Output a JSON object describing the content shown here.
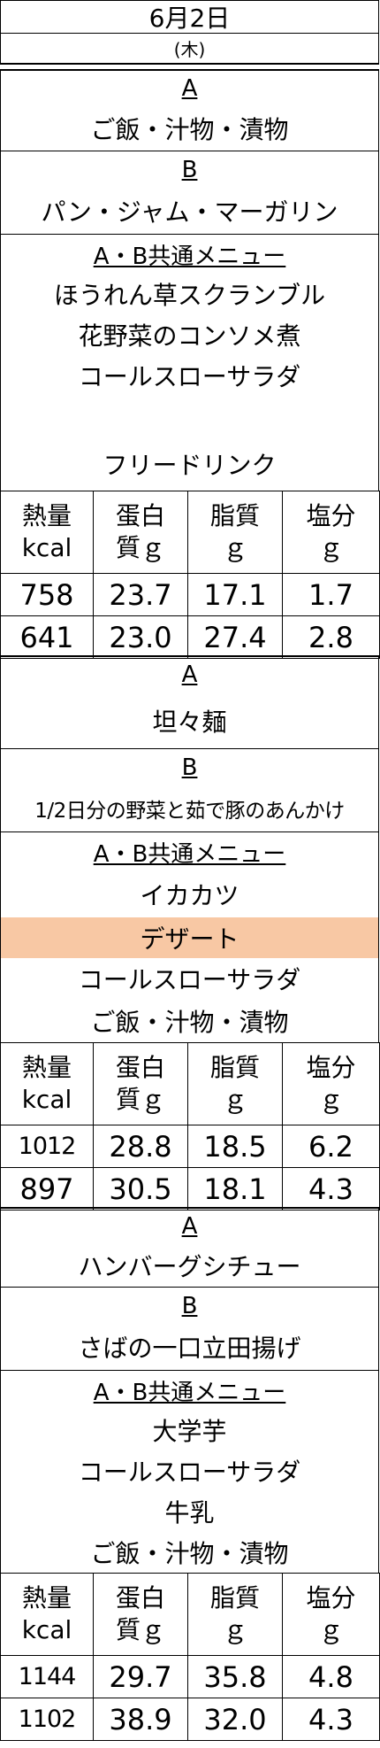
{
  "header": {
    "date": "6月2日",
    "weekday": "(木)"
  },
  "labels": {
    "a": "A",
    "b": "B",
    "common": "A・B共通メニュー"
  },
  "nutrition_headers": {
    "energy": [
      "熱量",
      "kcal"
    ],
    "protein": [
      "蛋白",
      "質ｇ"
    ],
    "fat": [
      "脂質",
      "ｇ"
    ],
    "salt": [
      "塩分",
      "ｇ"
    ]
  },
  "meals": [
    {
      "a_menu": "ご飯・汁物・漬物",
      "b_menu": "パン・ジャム・マーガリン",
      "common": [
        "ほうれん草スクランブル",
        "花野菜のコンソメ煮",
        "コールスローサラダ",
        "",
        "フリードリンク"
      ],
      "nutrition": [
        [
          "758",
          "23.7",
          "17.1",
          "1.7"
        ],
        [
          "641",
          "23.0",
          "27.4",
          "2.8"
        ]
      ]
    },
    {
      "a_menu": "坦々麺",
      "b_menu": "1/2日分の野菜と茹で豚のあんかけ",
      "common": [
        "イカカツ",
        "デザート",
        "コールスローサラダ",
        "ご飯・汁物・漬物"
      ],
      "nutrition": [
        [
          "1012",
          "28.8",
          "18.5",
          "6.2"
        ],
        [
          "897",
          "30.5",
          "18.1",
          "4.3"
        ]
      ]
    },
    {
      "a_menu": "ハンバーグシチュー",
      "b_menu": "さばの一口立田揚げ",
      "common": [
        "大学芋",
        "コールスローサラダ",
        "牛乳",
        "ご飯・汁物・漬物"
      ],
      "nutrition": [
        [
          "1144",
          "29.7",
          "35.8",
          "4.8"
        ],
        [
          "1102",
          "38.9",
          "32.0",
          "4.3"
        ]
      ]
    }
  ]
}
